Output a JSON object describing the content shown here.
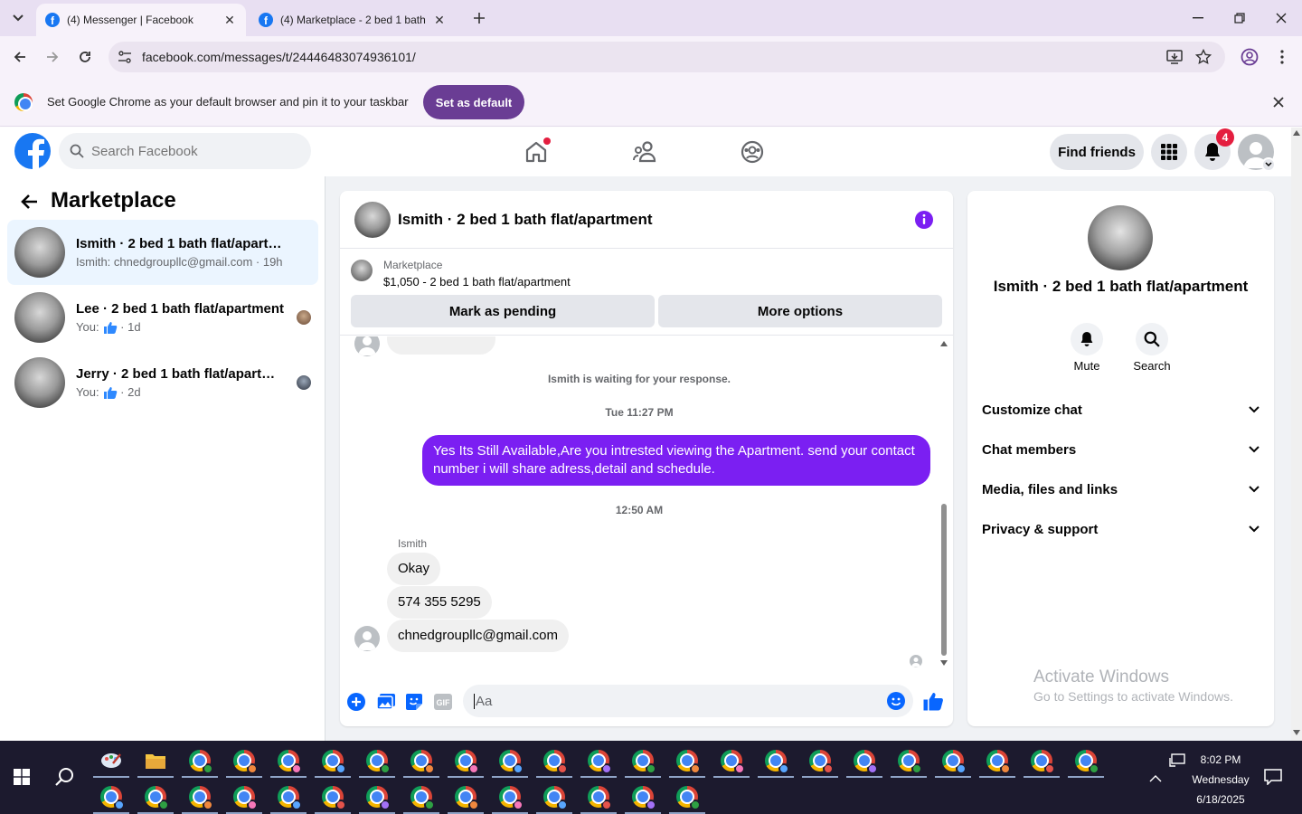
{
  "browser": {
    "tabs": [
      {
        "title": "(4) Messenger | Facebook",
        "active": true
      },
      {
        "title": "(4) Marketplace - 2 bed 1 bath flat/apartment",
        "active": false
      }
    ],
    "url": "facebook.com/messages/t/24446483074936101/",
    "infobar": {
      "text": "Set Google Chrome as your default browser and pin it to your taskbar",
      "button": "Set as default"
    }
  },
  "facebook": {
    "search_placeholder": "Search Facebook",
    "find_friends": "Find friends",
    "notification_count": "4"
  },
  "sidebar": {
    "title": "Marketplace",
    "conversations": [
      {
        "name": "Ismith · 2 bed 1 bath flat/apartment",
        "preview": "Ismith: chnedgroupllc@gmail.com",
        "time": "19h",
        "active": true
      },
      {
        "name": "Lee · 2 bed 1 bath flat/apartment",
        "preview": "You:",
        "time": "1d",
        "active": false
      },
      {
        "name": "Jerry · 2 bed 1 bath flat/apartment",
        "preview": "You:",
        "time": "2d",
        "active": false
      }
    ],
    "separator": " · "
  },
  "chat": {
    "title": "Ismith · 2 bed 1 bath flat/apartment",
    "listing": {
      "label": "Marketplace",
      "detail": "$1,050 - 2 bed 1 bath flat/apartment"
    },
    "buttons": {
      "pending": "Mark as pending",
      "more": "More options"
    },
    "waiting_note": "Ismith is waiting for your response.",
    "time1": "Tue 11:27 PM",
    "outgoing_message": "Yes Its Still Available,Are you intrested viewing the Apartment. send your contact number i will share adress,detail and schedule.",
    "time2": "12:50 AM",
    "sender": "Ismith",
    "incoming_messages": [
      "Okay",
      "574 355 5295",
      "chnedgroupllc@gmail.com"
    ],
    "composer_placeholder": "Aa"
  },
  "info_panel": {
    "title": "Ismith · 2 bed 1 bath flat/apartment",
    "actions": [
      {
        "label": "Mute",
        "icon": "bell-icon"
      },
      {
        "label": "Search",
        "icon": "search-icon"
      }
    ],
    "sections": [
      "Customize chat",
      "Chat members",
      "Media, files and links",
      "Privacy & support"
    ]
  },
  "watermark": {
    "line1": "Activate Windows",
    "line2": "Go to Settings to activate Windows."
  },
  "taskbar": {
    "time": "8:02 PM",
    "day": "Wednesday",
    "date": "6/18/2025"
  },
  "colors": {
    "accent": "#7b1ff2",
    "facebook_blue": "#1877f2",
    "notification_red": "#e41e3f",
    "chrome_infobar_button": "#6a3d94"
  }
}
